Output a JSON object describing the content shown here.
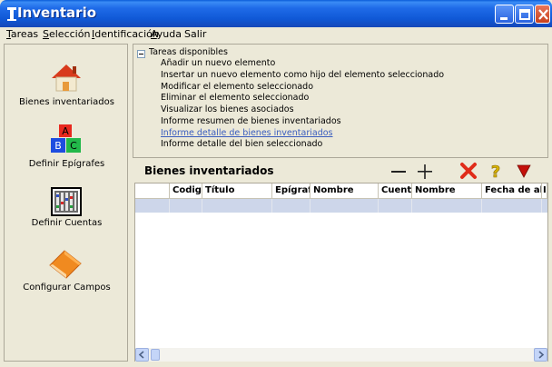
{
  "window": {
    "title": "Inventario"
  },
  "menu": [
    {
      "key": "T",
      "rest": "areas"
    },
    {
      "key": "S",
      "rest": "elección"
    },
    {
      "key": "I",
      "rest": "dentificación"
    },
    {
      "key": "A",
      "rest": "yuda"
    },
    {
      "key": "S",
      "pre": "Sa",
      "rest": "lir"
    }
  ],
  "nav": {
    "items": [
      {
        "label": "Bienes inventariados",
        "icon": "house-icon"
      },
      {
        "label": "Definir Epígrafes",
        "icon": "abc-blocks-icon"
      },
      {
        "label": "Definir Cuentas",
        "icon": "abacus-icon"
      },
      {
        "label": "Configurar Campos",
        "icon": "folder-orange-icon"
      }
    ]
  },
  "tasks": {
    "root": "Tareas disponibles",
    "items": [
      "Añadir un nuevo elemento",
      "Insertar un nuevo elemento como hijo del elemento seleccionado",
      "Modificar el elemento seleccionado",
      "Eliminar el elemento seleccionado",
      "Visualizar los bienes asociados",
      "Informe resumen de bienes inventariados",
      "Informe detalle de bienes inventariados",
      "Informe detalle del bien seleccionado"
    ],
    "highlighted_index": 6
  },
  "grid": {
    "title": "Bienes inventariados",
    "columns": [
      "",
      "Codigo",
      "Título",
      "Epígrafe",
      "Nombre",
      "Cuenta",
      "Nombre",
      "Fecha de alta",
      "I"
    ],
    "rows": [
      [
        "",
        "",
        "",
        "",
        "",
        "",
        "",
        "",
        ""
      ]
    ]
  },
  "toolbar": {
    "icons": [
      "minus-icon",
      "plus-icon",
      "delete-x-icon",
      "help-question-icon",
      "filter-down-icon"
    ]
  },
  "colors": {
    "titlebar": "#0f58d6",
    "selected_row": "#cdd6ea",
    "link": "#3a5dbf",
    "delete": "#e02c1a",
    "help": "#d8b400",
    "filter": "#c4100a"
  }
}
